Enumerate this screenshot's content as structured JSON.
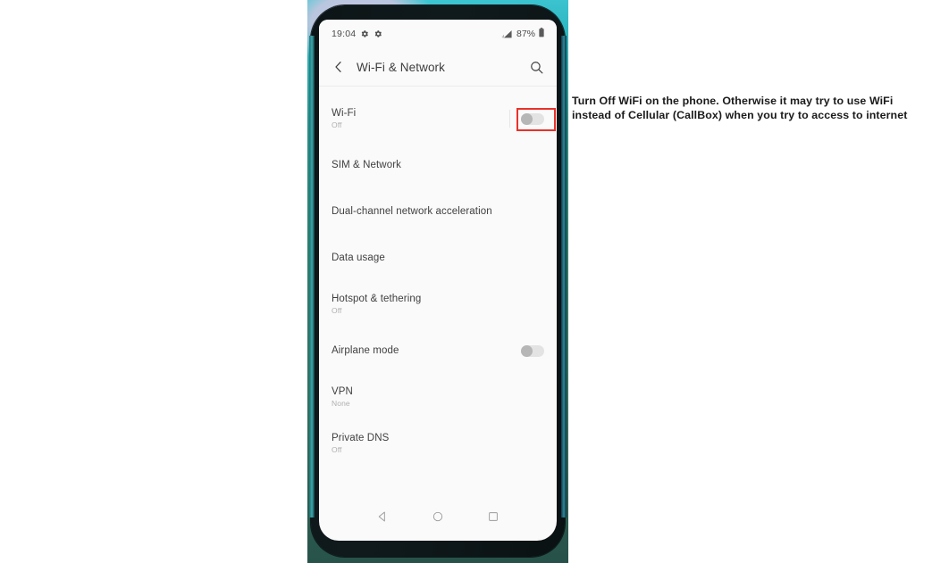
{
  "annotation": {
    "text": "Turn Off WiFi on the phone. Otherwise it may try to use WiFi instead of Cellular (CallBox) when you try to access to internet"
  },
  "phone": {
    "status_bar": {
      "time": "19:04",
      "left_icons": [
        "gear-icon",
        "gear-icon"
      ],
      "signal_icon": "cellular-signal-icon",
      "battery_percent": "87%",
      "battery_icon": "battery-icon"
    },
    "app_bar": {
      "back_icon": "back-chevron-icon",
      "title": "Wi-Fi & Network",
      "search_icon": "search-icon"
    },
    "settings_rows": [
      {
        "title": "Wi-Fi",
        "subtitle": "Off",
        "control": "toggle",
        "toggle_state": "off",
        "highlighted": true
      },
      {
        "title": "SIM & Network",
        "subtitle": "",
        "control": "none",
        "toggle_state": "",
        "highlighted": false
      },
      {
        "title": "Dual-channel network acceleration",
        "subtitle": "",
        "control": "none",
        "toggle_state": "",
        "highlighted": false
      },
      {
        "title": "Data usage",
        "subtitle": "",
        "control": "none",
        "toggle_state": "",
        "highlighted": false
      },
      {
        "title": "Hotspot & tethering",
        "subtitle": "Off",
        "control": "none",
        "toggle_state": "",
        "highlighted": false
      },
      {
        "title": "Airplane mode",
        "subtitle": "",
        "control": "toggle",
        "toggle_state": "off",
        "highlighted": false
      },
      {
        "title": "VPN",
        "subtitle": "None",
        "control": "none",
        "toggle_state": "",
        "highlighted": false
      },
      {
        "title": "Private DNS",
        "subtitle": "Off",
        "control": "none",
        "toggle_state": "",
        "highlighted": false
      }
    ],
    "nav_bar": {
      "back": "nav-back-triangle-icon",
      "home": "nav-home-circle-icon",
      "recents": "nav-recents-square-icon"
    }
  },
  "colors": {
    "highlight_red": "#e8322a",
    "screen_bg": "#fafafa",
    "title_text": "#3d3d3d",
    "subtitle_text": "#b0b0b0",
    "toggle_track_off": "#e3e3e3",
    "toggle_knob_off": "#b6b6b6",
    "bezel": "#0c1416",
    "backdrop_teal": "#2a8f86"
  }
}
